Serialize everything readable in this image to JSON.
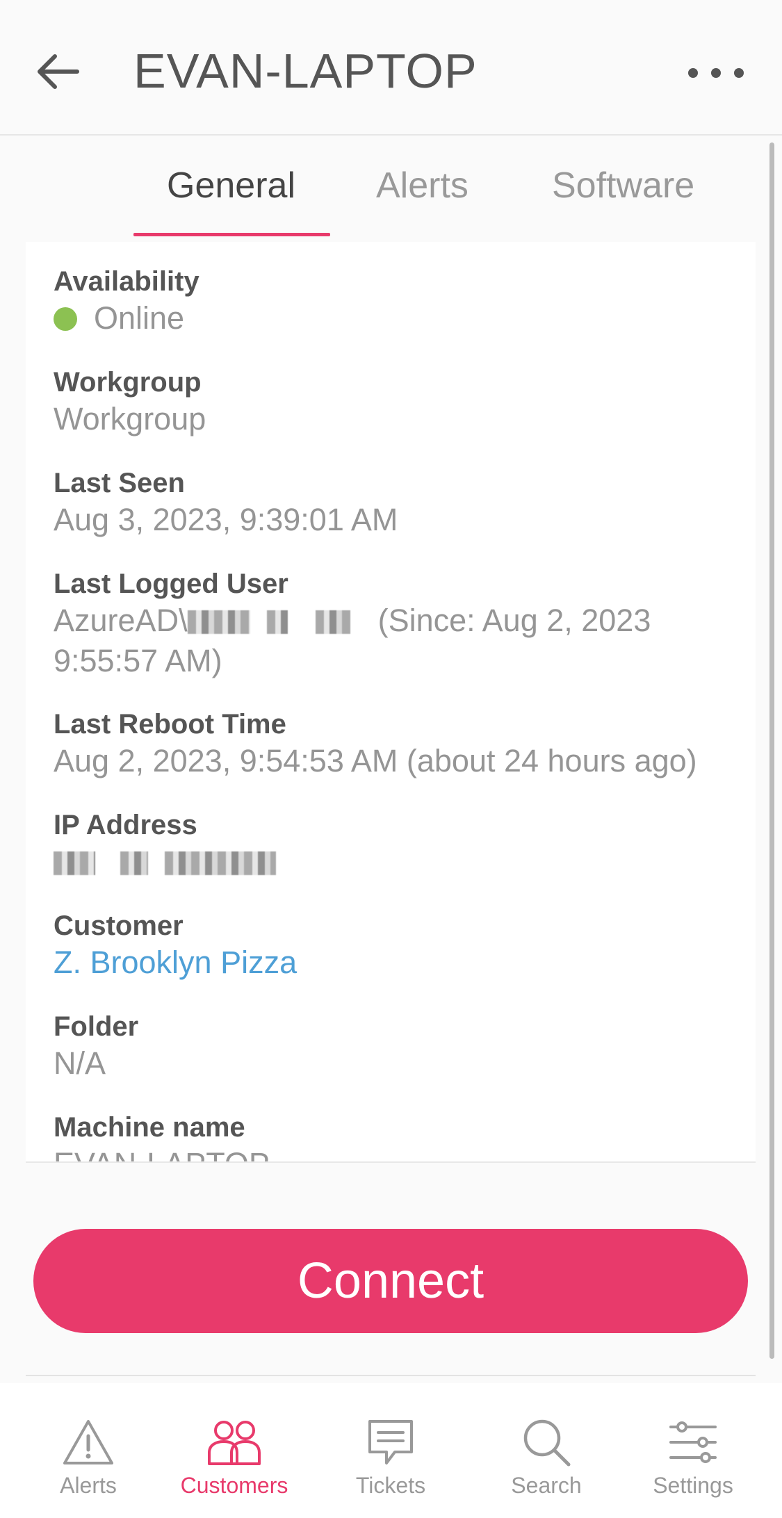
{
  "header": {
    "title": "EVAN-LAPTOP"
  },
  "tabs": [
    {
      "label": "General",
      "active": true
    },
    {
      "label": "Alerts",
      "active": false
    },
    {
      "label": "Software",
      "active": false
    }
  ],
  "fields": {
    "availability": {
      "label": "Availability",
      "value": "Online",
      "status_color": "#8cc152"
    },
    "workgroup": {
      "label": "Workgroup",
      "value": "Workgroup"
    },
    "last_seen": {
      "label": "Last Seen",
      "value": "Aug 3, 2023, 9:39:01 AM"
    },
    "last_logged_user": {
      "label": "Last Logged User",
      "prefix": "AzureAD\\",
      "suffix": "(Since: Aug 2, 2023",
      "line2": "9:55:57 AM)"
    },
    "last_reboot": {
      "label": "Last Reboot Time",
      "value": "Aug 2, 2023, 9:54:53 AM (about 24 hours ago)"
    },
    "ip_address": {
      "label": "IP Address"
    },
    "customer": {
      "label": "Customer",
      "value": "Z. Brooklyn Pizza"
    },
    "folder": {
      "label": "Folder",
      "value": "N/A"
    },
    "machine_name": {
      "label": "Machine name",
      "value": "EVAN-LAPTOP"
    }
  },
  "connect": {
    "label": "Connect",
    "color": "#e83a6b"
  },
  "bottom_nav": [
    {
      "label": "Alerts",
      "icon": "alert-triangle-icon",
      "active": false
    },
    {
      "label": "Customers",
      "icon": "users-icon",
      "active": true
    },
    {
      "label": "Tickets",
      "icon": "ticket-message-icon",
      "active": false
    },
    {
      "label": "Search",
      "icon": "search-icon",
      "active": false
    },
    {
      "label": "Settings",
      "icon": "sliders-icon",
      "active": false
    }
  ]
}
